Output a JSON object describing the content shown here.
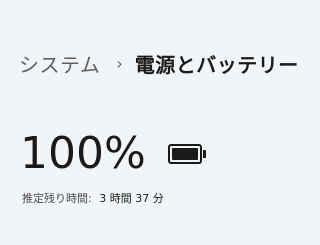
{
  "breadcrumb": {
    "parent": "システム",
    "separator": "›",
    "current": "電源とバッテリー"
  },
  "battery": {
    "percent_text": "100%",
    "level": 1.0,
    "icon": "battery-full-icon",
    "remaining_label": "推定残り時間:",
    "remaining_value": "3 時間 37 分"
  },
  "colors": {
    "background": "#f2f5f8",
    "text": "#1a1a1a",
    "muted": "#5f5f5f"
  }
}
